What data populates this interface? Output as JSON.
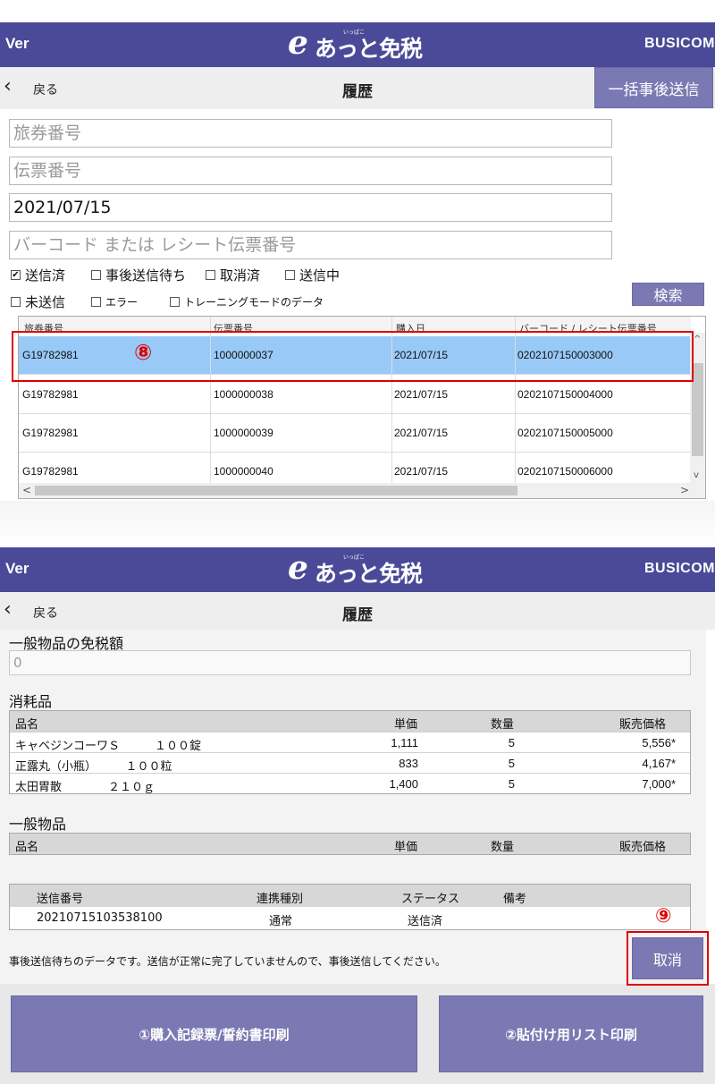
{
  "header": {
    "ver": "Ver",
    "logo_e": "e",
    "logo_text": "あっと免税",
    "logo_ruby": "いっぱこ",
    "brand": "BUSICOM"
  },
  "nav": {
    "back_label": "戻る",
    "title": "履歴",
    "batch_send_label": "一括事後送信"
  },
  "search": {
    "passport_placeholder": "旅券番号",
    "voucher_placeholder": "伝票番号",
    "date_value": "2021/07/15",
    "barcode_placeholder": "バーコード または レシート伝票番号",
    "search_label": "検索"
  },
  "filters": [
    {
      "label": "送信済",
      "checked": true
    },
    {
      "label": "事後送信待ち",
      "checked": false
    },
    {
      "label": "取消済",
      "checked": false
    },
    {
      "label": "送信中",
      "checked": false
    },
    {
      "label": "未送信",
      "checked": false
    },
    {
      "label": "エラー",
      "checked": false
    },
    {
      "label": "トレーニングモードのデータ",
      "checked": false
    }
  ],
  "history_grid": {
    "columns": [
      "旅券番号",
      "伝票番号",
      "購入日",
      "バーコード / レシート伝票番号"
    ],
    "rows": [
      {
        "passport": "G19782981",
        "voucher": "1000000037",
        "date": "2021/07/15",
        "barcode": "0202107150003000",
        "selected": true
      },
      {
        "passport": "G19782981",
        "voucher": "1000000038",
        "date": "2021/07/15",
        "barcode": "0202107150004000",
        "selected": false
      },
      {
        "passport": "G19782981",
        "voucher": "1000000039",
        "date": "2021/07/15",
        "barcode": "0202107150005000",
        "selected": false
      },
      {
        "passport": "G19782981",
        "voucher": "1000000040",
        "date": "2021/07/15",
        "barcode": "0202107150006000",
        "selected": false
      }
    ]
  },
  "annotations": {
    "step8": "⑧",
    "step9": "⑨"
  },
  "detail": {
    "general_tax_free_label": "一般物品の免税額",
    "general_tax_free_value": "0",
    "consumables_label": "消耗品",
    "general_goods_label": "一般物品",
    "item_columns": {
      "name": "品名",
      "unit_price": "単価",
      "qty": "数量",
      "price": "販売価格"
    },
    "consumables": [
      {
        "name": "キャベジンコーワＳ　　　１００錠",
        "unit_price": "1,111",
        "qty": "5",
        "price": "5,556*"
      },
      {
        "name": "正露丸（小瓶）　　　１００粒",
        "unit_price": "833",
        "qty": "5",
        "price": "4,167*"
      },
      {
        "name": "太田胃散　　　　２１０ｇ",
        "unit_price": "1,400",
        "qty": "5",
        "price": "7,000*"
      }
    ],
    "send_columns": {
      "send_no": "送信番号",
      "link_type": "連携種別",
      "status": "ステータス",
      "note": "備考"
    },
    "send_row": {
      "send_no": "20210715103538100",
      "link_type": "通常",
      "status": "送信済",
      "note": ""
    },
    "notice": "事後送信待ちのデータです。送信が正常に完了していませんので、事後送信してください。",
    "cancel_label": "取消",
    "print_record_label": "①購入記録票/誓約書印刷",
    "print_list_label": "②貼付け用リスト印刷"
  },
  "colors": {
    "header_bg": "#4a4a98",
    "button_bg": "#7b79b3",
    "selected_row": "#99c9f7",
    "annotation_red": "#e00000"
  }
}
